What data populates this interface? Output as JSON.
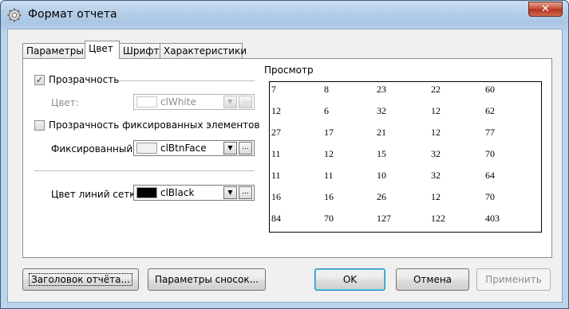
{
  "window": {
    "title": "Формат отчета",
    "close_glyph": "✕"
  },
  "tabs": [
    {
      "label": "Параметры",
      "active": false
    },
    {
      "label": "Цвет",
      "active": true
    },
    {
      "label": "Шрифт",
      "active": false
    },
    {
      "label": "Характеристики",
      "active": false
    }
  ],
  "color_tab": {
    "transparency": {
      "checked": true,
      "label": "Прозрачность",
      "check_glyph": "✓"
    },
    "color": {
      "label": "Цвет:",
      "value": "clWhite",
      "swatch": "#ffffff",
      "enabled": false
    },
    "fixed_transparency": {
      "checked": false,
      "label": "Прозрачность фиксированных элементов"
    },
    "fixed_color": {
      "label": "Фиксированный ц",
      "value": "clBtnFace",
      "swatch": "#f0f0f0"
    },
    "grid_color": {
      "label": "Цвет линий сетки",
      "value": "clBlack",
      "swatch": "#000000"
    },
    "dropdown_glyph": "▼",
    "ellipsis_glyph": "..."
  },
  "preview": {
    "title": "Просмотр",
    "rows": [
      [
        "7",
        "8",
        "23",
        "22",
        "60"
      ],
      [
        "12",
        "6",
        "32",
        "12",
        "62"
      ],
      [
        "27",
        "17",
        "21",
        "12",
        "77"
      ],
      [
        "11",
        "12",
        "15",
        "32",
        "70"
      ],
      [
        "11",
        "11",
        "10",
        "32",
        "64"
      ],
      [
        "16",
        "16",
        "26",
        "12",
        "70"
      ],
      [
        "84",
        "70",
        "127",
        "122",
        "403"
      ]
    ]
  },
  "buttons": {
    "report_header": "Заголовок отчёта...",
    "footnote_params": "Параметры сносок...",
    "ok": "OK",
    "cancel": "Отмена",
    "apply": "Применить"
  }
}
